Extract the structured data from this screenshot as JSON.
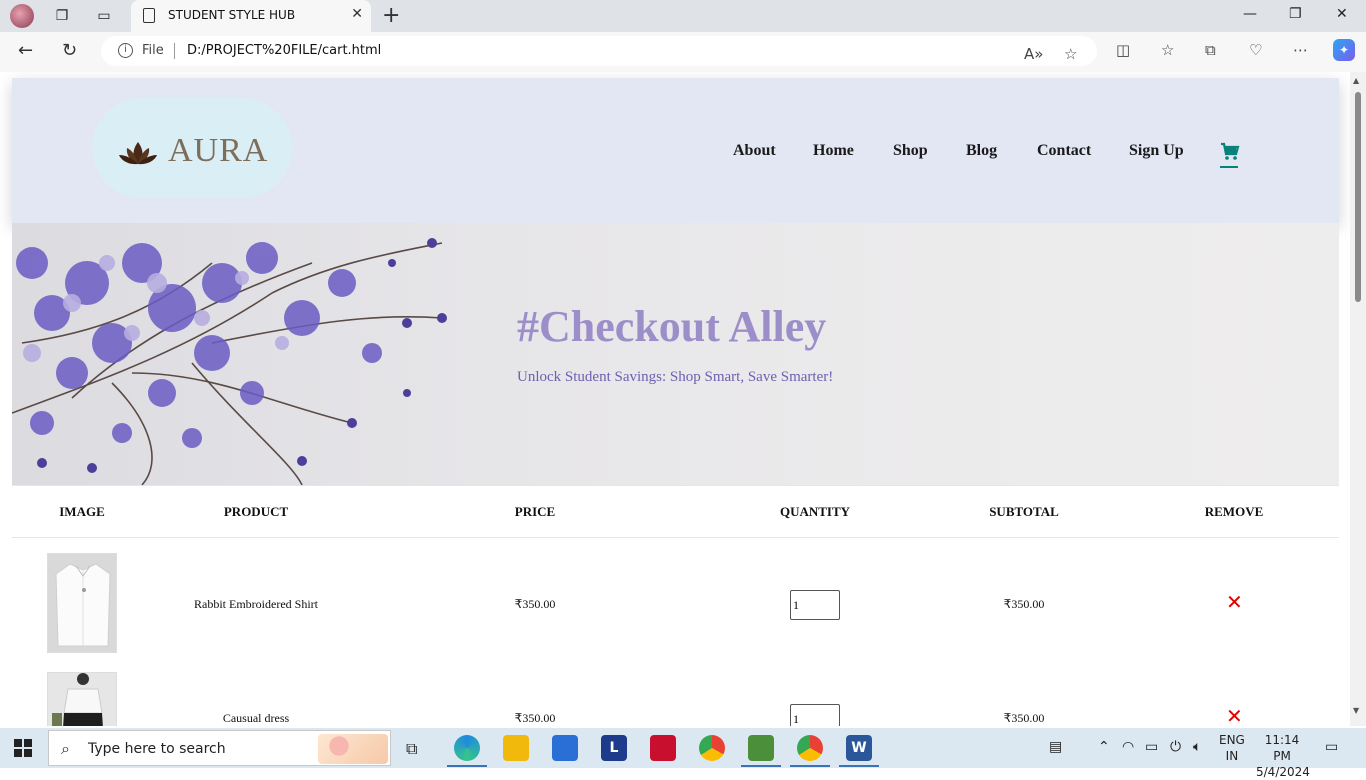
{
  "browser": {
    "tab_title": "STUDENT STYLE HUB",
    "url_scheme_label": "File",
    "url": "D:/PROJECT%20FILE/cart.html"
  },
  "site": {
    "logo_text": "AURA",
    "nav": [
      "About",
      "Home",
      "Shop",
      "Blog",
      "Contact",
      "Sign Up"
    ],
    "accent_color": "#088178",
    "banner": {
      "title": "#Checkout Alley",
      "subtitle": "Unlock Student Savings: Shop Smart, Save Smarter!"
    }
  },
  "cart": {
    "headers": [
      "IMAGE",
      "PRODUCT",
      "PRICE",
      "QUANTITY",
      "SUBTOTAL",
      "REMOVE"
    ],
    "rows": [
      {
        "product": "Rabbit Embroidered Shirt",
        "price": "₹350.00",
        "quantity": "1",
        "subtotal": "₹350.00"
      },
      {
        "product": "Causual dress",
        "price": "₹350.00",
        "quantity": "1",
        "subtotal": "₹350.00"
      }
    ]
  },
  "taskbar": {
    "search_placeholder": "Type here to search",
    "lang_top": "ENG",
    "lang_bottom": "IN",
    "time": "11:14 PM",
    "date": "5/4/2024"
  }
}
